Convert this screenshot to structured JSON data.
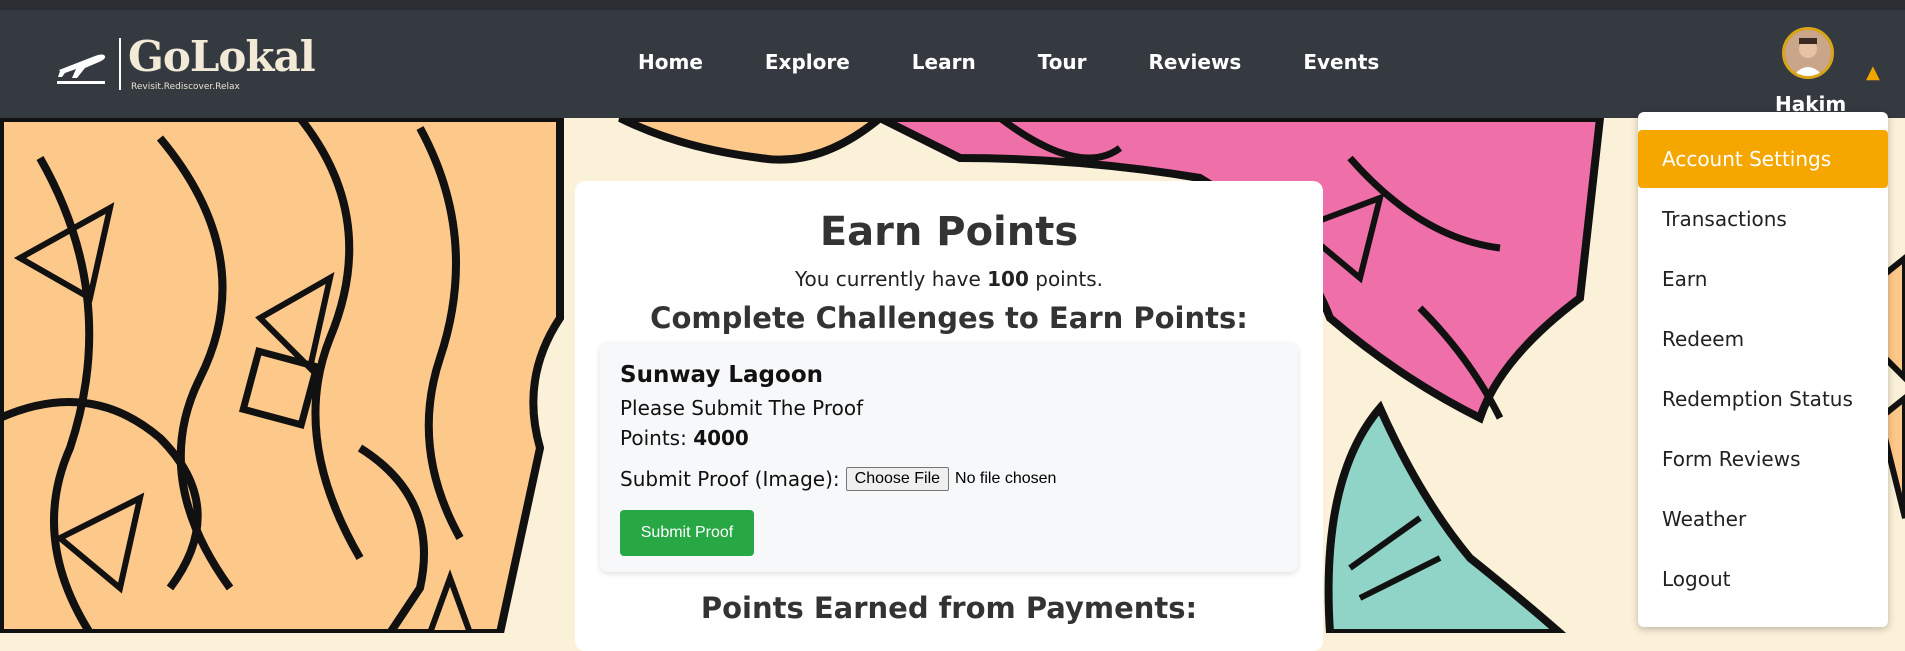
{
  "brand": {
    "name": "GoLokal",
    "tagline": "Revisit.Rediscover.Relax"
  },
  "nav": {
    "items": [
      "Home",
      "Explore",
      "Learn",
      "Tour",
      "Reviews",
      "Events"
    ]
  },
  "user": {
    "name": "Hakim"
  },
  "dropdown": {
    "items": [
      "Account Settings",
      "Transactions",
      "Earn",
      "Redeem",
      "Redemption Status",
      "Form Reviews",
      "Weather",
      "Logout"
    ],
    "active_index": 0
  },
  "main": {
    "title": "Earn Points",
    "points_prefix": "You currently have ",
    "points_value": "100",
    "points_suffix": " points.",
    "challenges_heading": "Complete Challenges to Earn Points:",
    "challenge": {
      "name": "Sunway Lagoon",
      "description": "Please Submit The Proof",
      "points_label": "Points: ",
      "points_value": "4000",
      "proof_label": "Submit Proof (Image):",
      "file_button": "Choose File",
      "file_status": "No file chosen",
      "submit_label": "Submit Proof"
    },
    "payments_heading": "Points Earned from Payments:"
  },
  "colors": {
    "navbar": "#343a40",
    "accent": "#f5a700",
    "submit": "#28a745",
    "bg_orange": "#fdc98a",
    "bg_pink": "#ef6fa8",
    "bg_teal": "#8fd4c6"
  }
}
